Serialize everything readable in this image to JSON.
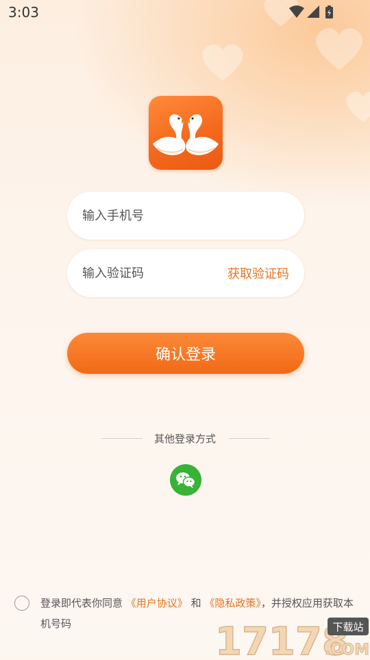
{
  "status_bar": {
    "time": "3:03"
  },
  "colors": {
    "accent": "#e8731f",
    "button": "#f47a25",
    "wechat": "#37b335"
  },
  "login": {
    "phone_placeholder": "输入手机号",
    "code_placeholder": "输入验证码",
    "get_code_label": "获取验证码",
    "submit_label": "确认登录"
  },
  "other_login": {
    "label": "其他登录方式",
    "icons": [
      "wechat-icon"
    ]
  },
  "agreement": {
    "prefix": "登录即代表你同意",
    "user_agreement": "《用户协议》",
    "and": "和",
    "privacy_policy": "《隐私政策》",
    "suffix": "，并授权应用获取本机号码"
  },
  "watermark": {
    "text": "17178",
    "badge": "下载站",
    "domain": ".COM"
  }
}
